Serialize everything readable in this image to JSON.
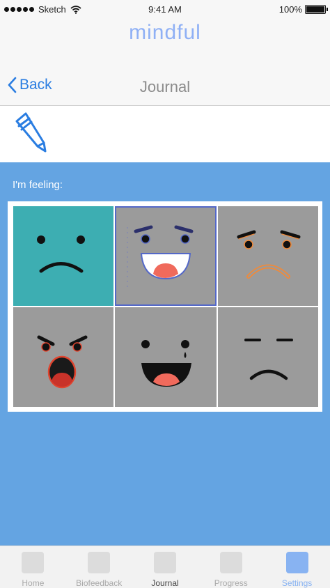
{
  "status": {
    "carrier": "Sketch",
    "time": "9:41 AM",
    "battery": "100%"
  },
  "app": {
    "title": "mindful"
  },
  "nav": {
    "back_label": "Back",
    "title": "Journal"
  },
  "toolbar": {
    "icon": "pencil-icon"
  },
  "mood": {
    "prompt": "I'm feeling:",
    "options": [
      {
        "icon": "sad-face-icon",
        "selected": true
      },
      {
        "icon": "happy-face-icon",
        "selected": false
      },
      {
        "icon": "worried-face-icon",
        "selected": false
      },
      {
        "icon": "angry-face-icon",
        "selected": false
      },
      {
        "icon": "laughing-face-icon",
        "selected": false
      },
      {
        "icon": "disappointed-face-icon",
        "selected": false
      }
    ]
  },
  "tabs": [
    {
      "label": "Home",
      "state": "normal"
    },
    {
      "label": "Biofeedback",
      "state": "normal"
    },
    {
      "label": "Journal",
      "state": "current"
    },
    {
      "label": "Progress",
      "state": "normal"
    },
    {
      "label": "Settings",
      "state": "accent"
    }
  ],
  "colors": {
    "accent": "#2a7de1",
    "brand": "#8fb0f5",
    "mood_background": "#64a4e2",
    "selected_mood": "#3daeb2"
  }
}
